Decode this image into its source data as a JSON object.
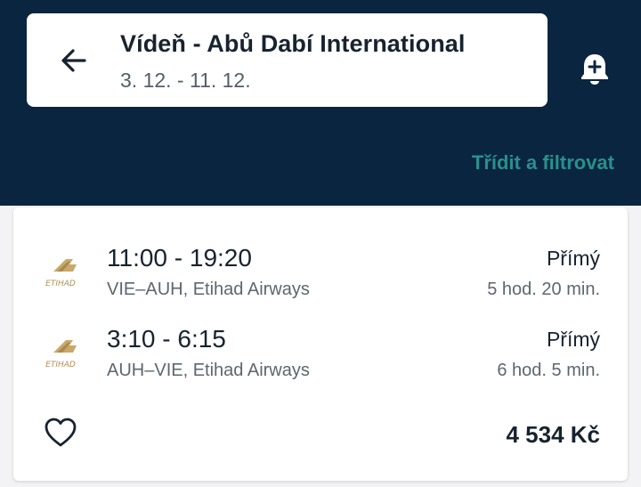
{
  "header": {
    "title": "Vídeň - Abů Dabí International",
    "dates": "3. 12. - 11. 12.",
    "back_icon": "arrow-left-icon",
    "alert_icon": "bell-plus-icon",
    "sort_filter_label": "Třídit a filtrovat",
    "background_color": "#0a2540",
    "accent_color": "#2a8f8f"
  },
  "result": {
    "legs": [
      {
        "times": "11:00 - 19:20",
        "route": "VIE–AUH, Etihad Airways",
        "stops": "Přímý",
        "duration": "5 hod. 20 min.",
        "logo": "etihad-logo"
      },
      {
        "times": "3:10 - 6:15",
        "route": "AUH–VIE, Etihad Airways",
        "stops": "Přímý",
        "duration": "6 hod. 5 min.",
        "logo": "etihad-logo"
      }
    ],
    "favorite_icon": "heart-outline-icon",
    "price": "4 534 Kč"
  }
}
